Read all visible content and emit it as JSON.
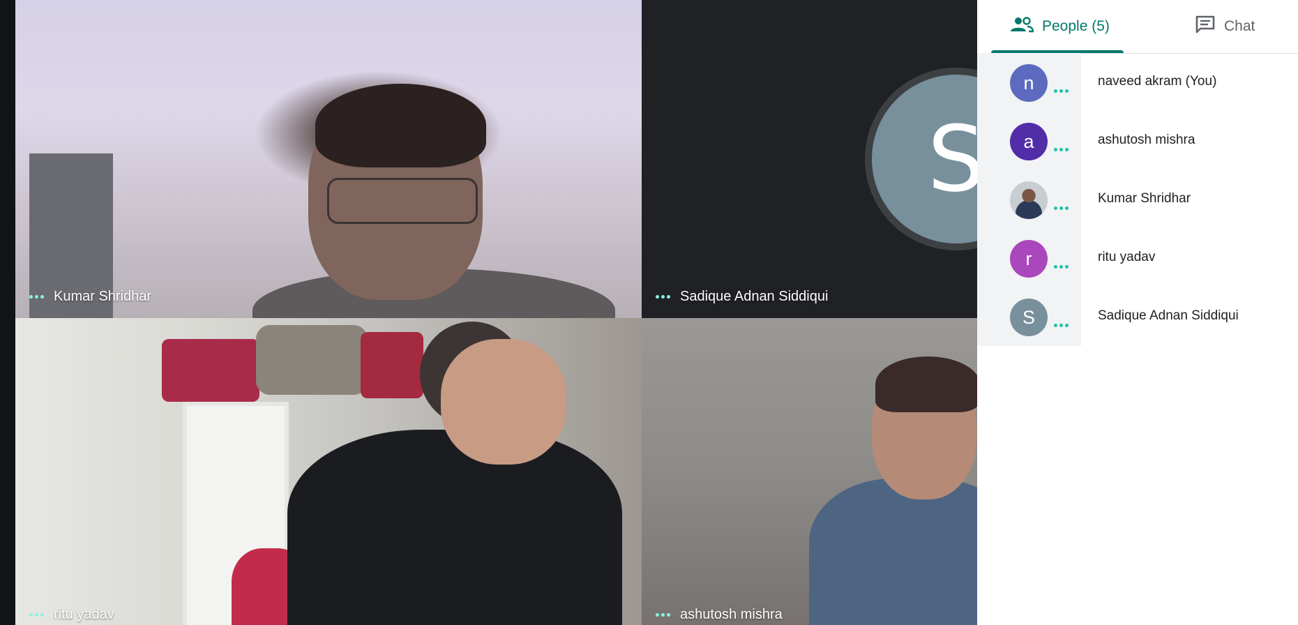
{
  "tiles": [
    {
      "name": "Kumar Shridhar"
    },
    {
      "name": "Sadique Adnan Siddiqui",
      "avatar_letter": "S",
      "avatar_color": "#78909c"
    },
    {
      "name": "ritu yadav"
    },
    {
      "name": "ashutosh mishra"
    }
  ],
  "panel": {
    "tabs": {
      "people": {
        "label": "People (5)",
        "icon": "people-icon",
        "active": true
      },
      "chat": {
        "label": "Chat",
        "icon": "chat-icon"
      }
    },
    "people": [
      {
        "name": "naveed akram (You)",
        "initial": "n",
        "color": "#5c6bc0"
      },
      {
        "name": "ashutosh mishra",
        "initial": "a",
        "color": "#512da8"
      },
      {
        "name": "Kumar Shridhar",
        "initial": "",
        "color": "photo"
      },
      {
        "name": "ritu yadav",
        "initial": "r",
        "color": "#ab47bc"
      },
      {
        "name": "Sadique Adnan Siddiqui",
        "initial": "S",
        "color": "#78909c"
      }
    ]
  },
  "colors": {
    "accent": "#00796b",
    "activity_dots": "#1ec1a7",
    "tile_label_dots": "#8cf2e1"
  }
}
